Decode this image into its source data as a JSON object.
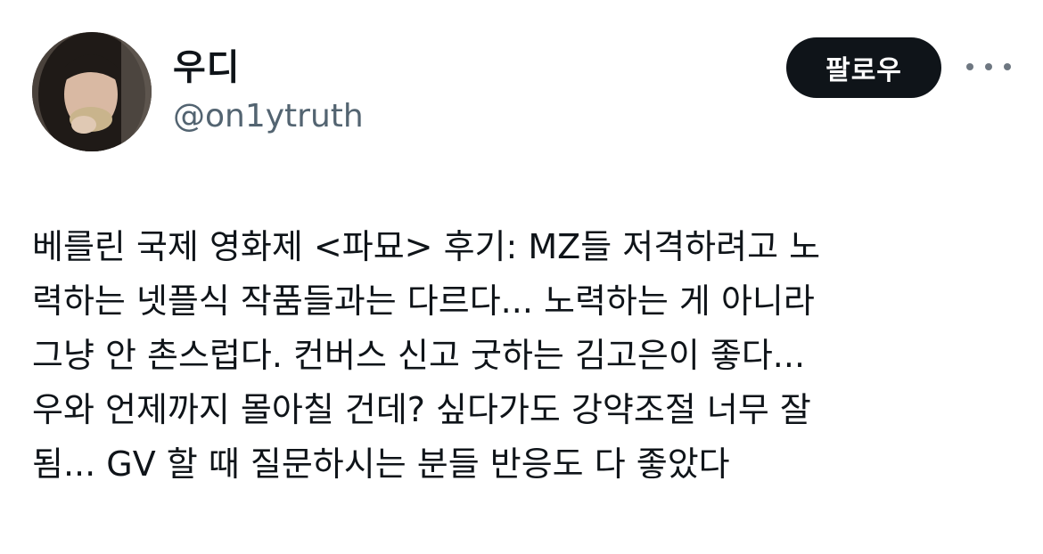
{
  "author": {
    "display_name": "우디",
    "handle": "@on1ytruth"
  },
  "follow_button": {
    "label": "팔로우"
  },
  "more_menu": {
    "icon": "more-horizontal-icon"
  },
  "tweet": {
    "text": "베를린 국제 영화제 <파묘> 후기: MZ들 저격하려고 노\n력하는 넷플식 작품들과는 다르다... 노력하는 게 아니라\n그냥 안 촌스럽다. 컨버스 신고 굿하는 김고은이 좋다...\n우와 언제까지 몰아칠 건데? 싶다가도 강약조절 너무 잘\n됨... GV 할 때 질문하시는 분들 반응도 다 좋았다"
  },
  "colors": {
    "text": "#0f1419",
    "secondary_text": "#536471",
    "button_bg": "#0f1419",
    "button_text": "#ffffff"
  }
}
